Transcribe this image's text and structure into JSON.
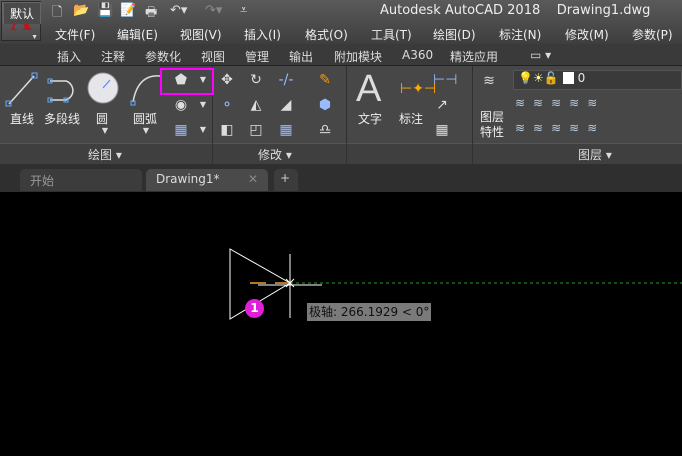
{
  "titlebar": {
    "app_icon": "A",
    "title": "Autodesk AutoCAD 2018",
    "document": "Drawing1.dwg",
    "quick_access": [
      "new-icon",
      "open-icon",
      "save-icon",
      "saveas-icon",
      "print-icon",
      "undo-icon",
      "redo-icon",
      "customize-icon"
    ]
  },
  "menu": [
    "文件(F)",
    "编辑(E)",
    "视图(V)",
    "插入(I)",
    "格式(O)",
    "工具(T)",
    "绘图(D)",
    "标注(N)",
    "修改(M)",
    "参数(P)"
  ],
  "ribbon_tabs": [
    "默认",
    "插入",
    "注释",
    "参数化",
    "视图",
    "管理",
    "输出",
    "附加模块",
    "A360",
    "精选应用"
  ],
  "panels": {
    "draw": {
      "title": "绘图",
      "tools": [
        "直线",
        "多段线",
        "圆",
        "圆弧"
      ]
    },
    "modify": {
      "title": "修改"
    },
    "annotation": {
      "tools": [
        "文字",
        "标注"
      ]
    },
    "layers": {
      "title": "图层",
      "properties_line1": "图层",
      "properties_line2": "特性",
      "current_layer": "0"
    }
  },
  "doc_tabs": [
    {
      "label": "开始"
    },
    {
      "label": "Drawing1*"
    }
  ],
  "canvas": {
    "marker": "1",
    "tooltip": "极轴: 266.1929 < 0°"
  },
  "colors": {
    "accent": "#ff00ff",
    "marker": "#e020d8",
    "tracking": "#1fa01f"
  }
}
